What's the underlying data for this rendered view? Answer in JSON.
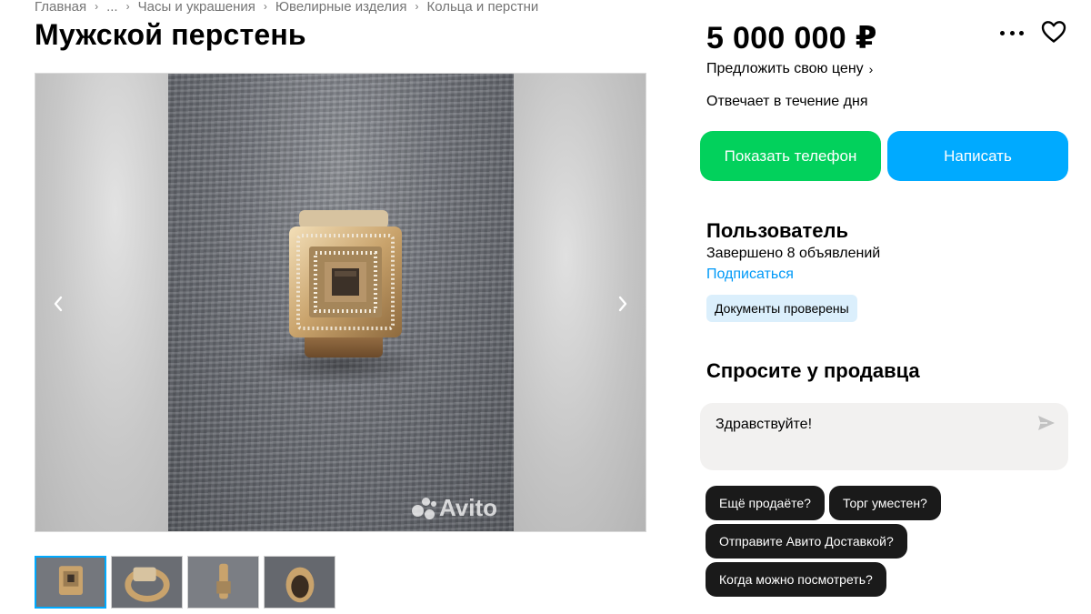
{
  "breadcrumb": {
    "items": [
      "Главная",
      "...",
      "Часы и украшения",
      "Ювелирные изделия",
      "Кольца и перстни"
    ],
    "separator": "›"
  },
  "listing": {
    "title": "Мужской перстень",
    "price": "5 000 000 ₽",
    "offer_price_label": "Предложить свою цену",
    "reply_time": "Отвечает в течение дня"
  },
  "actions": {
    "show_phone_label": "Показать телефон",
    "write_label": "Написать",
    "show_phone_color": "#02d15c",
    "write_color": "#00aaff"
  },
  "seller": {
    "name": "Пользователь",
    "completed": "Завершено 8 объявлений",
    "subscribe_label": "Подписаться",
    "badge": "Документы проверены"
  },
  "ask": {
    "heading": "Спросите у продавца",
    "message_value": "Здравствуйте!",
    "quick_replies": [
      "Ещё продаёте?",
      "Торг уместен?",
      "Отправите Авито Доставкой?",
      "Когда можно посмотреть?"
    ]
  },
  "gallery": {
    "watermark": "Avito",
    "thumbnail_count": 4,
    "active_thumbnail": 1
  },
  "icons": {
    "more": "more-dots-icon",
    "favorite": "heart-icon",
    "send": "send-icon",
    "prev": "chevron-left-icon",
    "next": "chevron-right-icon"
  }
}
